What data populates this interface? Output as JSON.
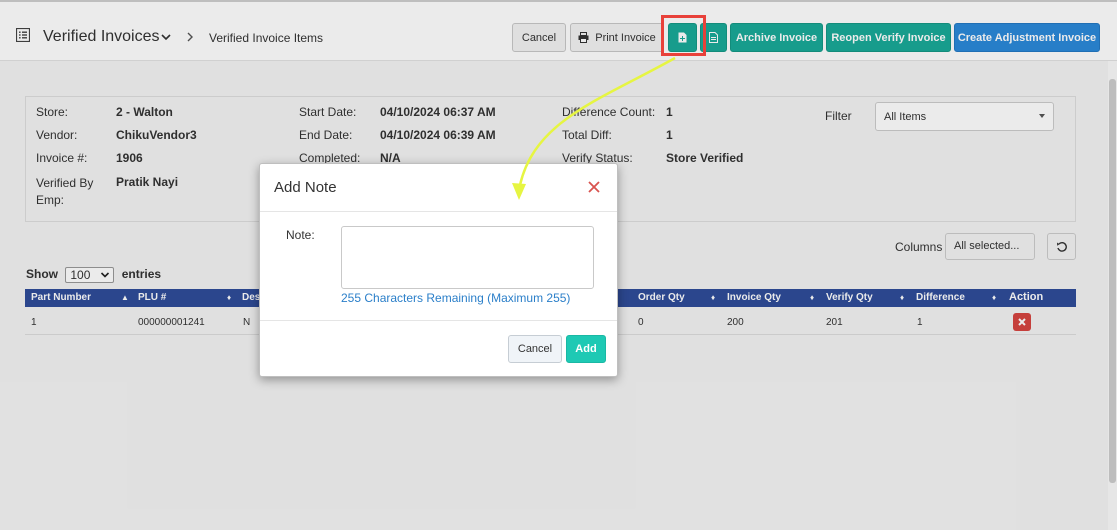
{
  "header": {
    "title": "Verified Invoices",
    "breadcrumb": "Verified Invoice Items",
    "buttons": {
      "cancel": "Cancel",
      "print": "Print Invoice",
      "archive": "Archive Invoice",
      "reopen": "Reopen Verify Invoice",
      "create_adjustment": "Create Adjustment Invoice"
    }
  },
  "info": {
    "store_label": "Store:",
    "store_value": "2 - Walton",
    "vendor_label": "Vendor:",
    "vendor_value": "ChikuVendor3",
    "invoice_label": "Invoice #:",
    "invoice_value": "1906",
    "verified_label": "Verified By Emp:",
    "verified_value": "Pratik Nayi",
    "start_label": "Start Date:",
    "start_value": "04/10/2024 06:37 AM",
    "end_label": "End Date:",
    "end_value": "04/10/2024 06:39 AM",
    "completed_label": "Completed:",
    "completed_value": "N/A",
    "diffcount_label": "Difference Count:",
    "diffcount_value": "1",
    "totaldiff_label": "Total Diff:",
    "totaldiff_value": "1",
    "status_label": "Verify Status:",
    "status_value": "Store Verified",
    "filter_label": "Filter",
    "filter_value": "All Items"
  },
  "table_controls": {
    "columns_label": "Columns",
    "columns_value": "All selected...",
    "show_label": "Show",
    "show_value": "100",
    "entries_label": "entries"
  },
  "table": {
    "headers": {
      "part_number": "Part Number",
      "plu": "PLU #",
      "desc": "Des",
      "order_qty": "Order Qty",
      "invoice_qty": "Invoice Qty",
      "verify_qty": "Verify Qty",
      "difference": "Difference",
      "action": "Action"
    },
    "rows": [
      {
        "part_number": "1",
        "plu": "000000001241",
        "desc": "N",
        "order_qty": "0",
        "invoice_qty": "200",
        "verify_qty": "201",
        "difference": "1"
      }
    ]
  },
  "modal": {
    "title": "Add Note",
    "note_label": "Note:",
    "note_value": "",
    "char_remaining": "255 Characters Remaining (Maximum 255)",
    "cancel_label": "Cancel",
    "add_label": "Add"
  },
  "colors": {
    "teal": "#1aaa98",
    "blue": "#2b89d9",
    "table_header": "#2f4d9a",
    "highlight": "#e8413a",
    "arrow": "#e6f542"
  },
  "icons": [
    "list-icon",
    "chevron-down-icon",
    "chevron-right-icon",
    "printer-icon",
    "document-icon",
    "reset-icon",
    "close-icon",
    "delete-icon"
  ]
}
